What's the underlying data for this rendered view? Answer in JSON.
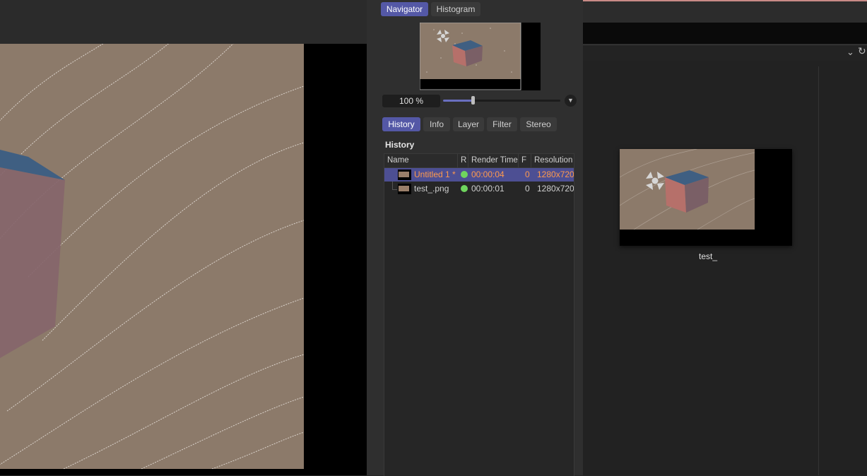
{
  "navigator": {
    "tabs": [
      {
        "label": "Navigator",
        "active": true
      },
      {
        "label": "Histogram",
        "active": false
      }
    ],
    "zoom": "100 %",
    "zoom_level": 0.25,
    "zoom_menu_icon": "chevron-down-icon"
  },
  "panel_tabs": [
    {
      "label": "History",
      "active": true
    },
    {
      "label": "Info",
      "active": false
    },
    {
      "label": "Layer",
      "active": false
    },
    {
      "label": "Filter",
      "active": false
    },
    {
      "label": "Stereo",
      "active": false
    }
  ],
  "history": {
    "title": "History",
    "columns": [
      "Name",
      "R",
      "Render Time",
      "F",
      "Resolution"
    ],
    "rows": [
      {
        "name": "Untitled 1 *",
        "render_time": "00:00:04",
        "f": "0",
        "resolution": "1280x720",
        "selected": true,
        "status_color": "#6fd55e"
      },
      {
        "name": "test_.png",
        "render_time": "00:00:01",
        "f": "0",
        "resolution": "1280x720",
        "selected": false,
        "status_color": "#6fd55e"
      }
    ]
  },
  "browser": {
    "thumbnail_caption": "test_",
    "icons": [
      "chevron-down-icon",
      "refresh-icon"
    ]
  },
  "colors": {
    "accent": "#5458a6",
    "selected_row_text": "#ff9a4d",
    "status_ok": "#6fd55e",
    "scene_background": "#8c7a6a",
    "cube_top": "#3f5f82",
    "cube_side": "#86656b"
  }
}
